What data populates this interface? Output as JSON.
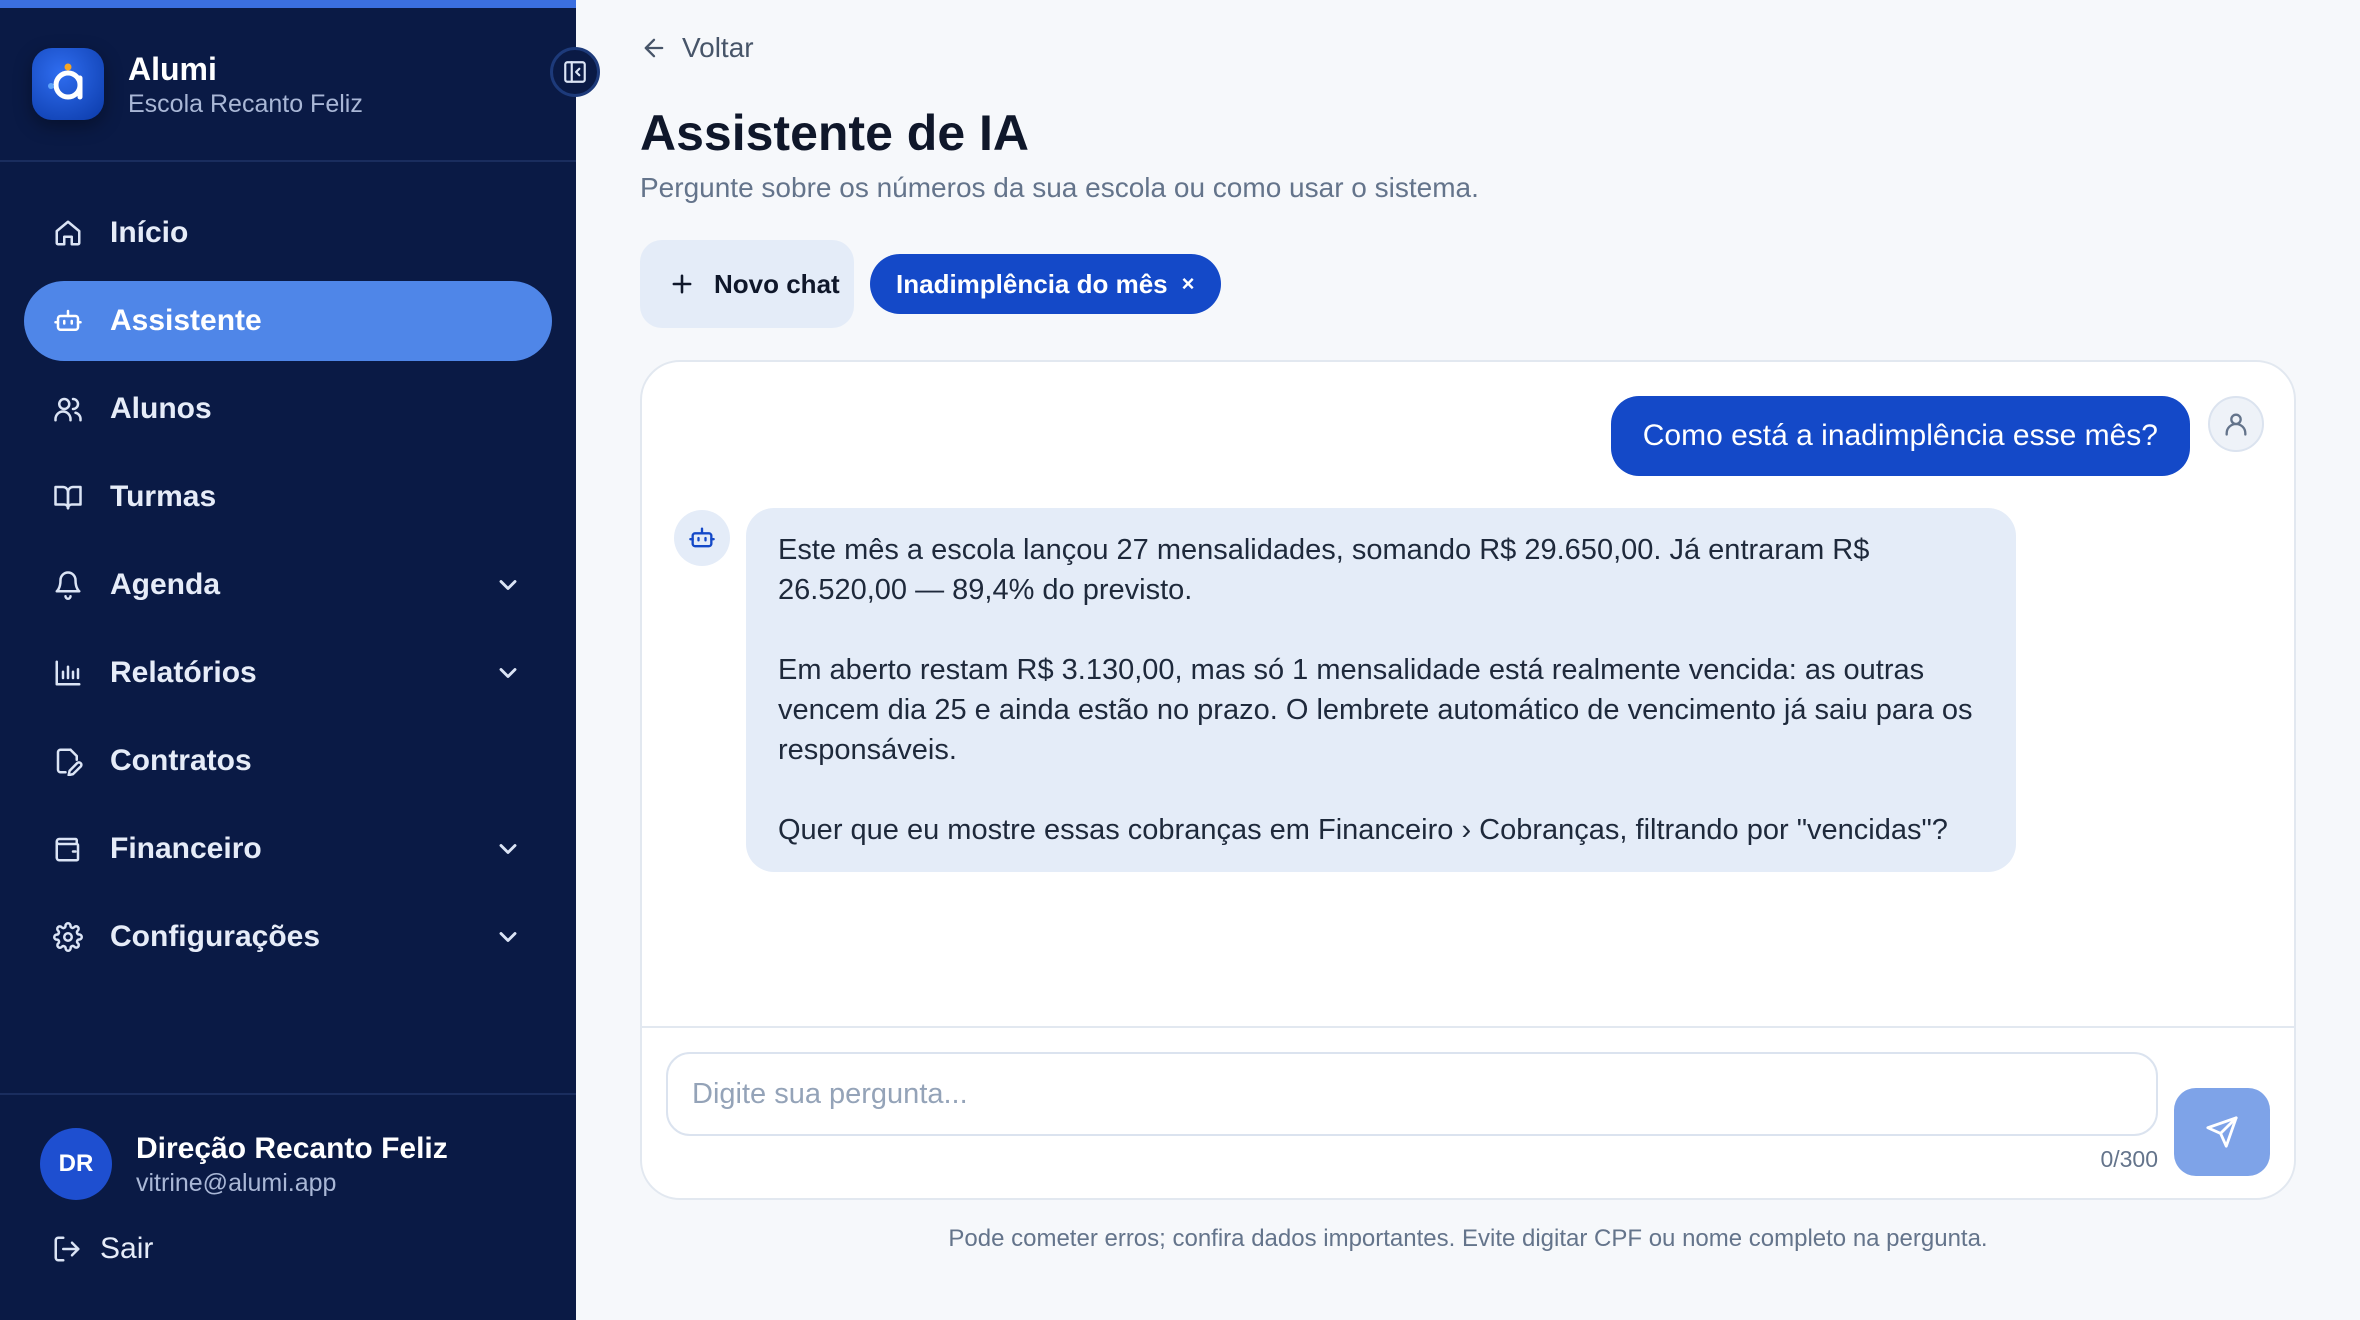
{
  "sidebar": {
    "app_name": "Alumi",
    "school_name": "Escola Recanto Feliz",
    "items": [
      {
        "label": "Início",
        "icon": "home-icon",
        "active": false,
        "expandable": false
      },
      {
        "label": "Assistente",
        "icon": "bot-icon",
        "active": true,
        "expandable": false
      },
      {
        "label": "Alunos",
        "icon": "users-icon",
        "active": false,
        "expandable": false
      },
      {
        "label": "Turmas",
        "icon": "book-icon",
        "active": false,
        "expandable": false
      },
      {
        "label": "Agenda",
        "icon": "bell-icon",
        "active": false,
        "expandable": true
      },
      {
        "label": "Relatórios",
        "icon": "chart-icon",
        "active": false,
        "expandable": true
      },
      {
        "label": "Contratos",
        "icon": "contract-icon",
        "active": false,
        "expandable": false
      },
      {
        "label": "Financeiro",
        "icon": "wallet-icon",
        "active": false,
        "expandable": true
      },
      {
        "label": "Configurações",
        "icon": "gear-icon",
        "active": false,
        "expandable": true
      }
    ],
    "user": {
      "initials": "DR",
      "name": "Direção Recanto Feliz",
      "email": "vitrine@alumi.app"
    },
    "logout_label": "Sair"
  },
  "main": {
    "back_label": "Voltar",
    "title": "Assistente de IA",
    "subtitle": "Pergunte sobre os números da sua escola ou como usar o sistema.",
    "new_chat_label": "Novo chat",
    "active_chat_chip": "Inadimplência do mês",
    "chip_close": "×",
    "messages": {
      "user": "Como está a inadimplência esse mês?",
      "bot": [
        "Este mês a escola lançou 27 mensalidades, somando R$ 29.650,00. Já entraram R$ 26.520,00 — 89,4% do previsto.",
        "Em aberto restam R$ 3.130,00, mas só 1 mensalidade está realmente vencida: as outras vencem dia 25 e ainda estão no prazo. O lembrete automático de vencimento já saiu para os responsáveis.",
        "Quer que eu mostre essas cobranças em Financeiro › Cobranças, filtrando por \"vencidas\"?"
      ]
    },
    "input": {
      "placeholder": "Digite sua pergunta...",
      "counter": "0/300"
    },
    "disclaimer": "Pode cometer erros; confira dados importantes. Evite digitar CPF ou nome completo na pergunta."
  },
  "colors": {
    "sidebar_bg": "#0a1a45",
    "accent": "#1449c8",
    "active_nav": "#4f86e8",
    "bubble_bot": "#e4ecf8"
  }
}
